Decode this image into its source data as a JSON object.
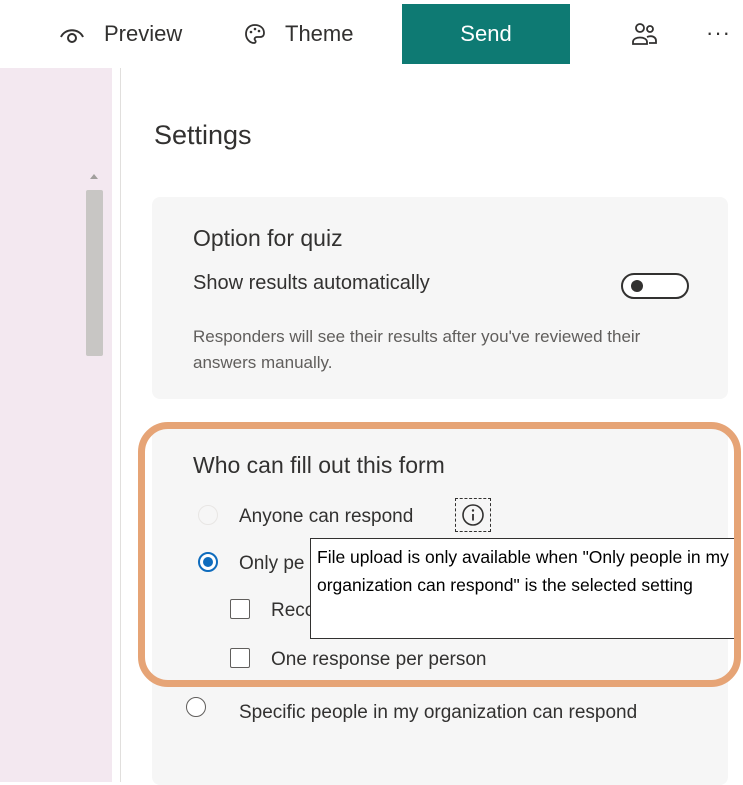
{
  "toolbar": {
    "preview_label": "Preview",
    "preview_icon": "eye-icon",
    "theme_label": "Theme",
    "theme_icon": "palette-icon",
    "send_label": "Send",
    "send_color": "#0e7a73",
    "share_icon": "people-icon",
    "more_label": "···"
  },
  "settings": {
    "title": "Settings",
    "quiz": {
      "title": "Option for quiz",
      "show_results_label": "Show results automatically",
      "show_results_on": false,
      "hint": "Responders will see their results after you've reviewed their answers manually."
    },
    "who": {
      "title": "Who can fill out this form",
      "options": [
        {
          "label": "Anyone can respond",
          "selected": false,
          "disabled": true
        },
        {
          "label": "Only pe",
          "selected": true,
          "disabled": false
        },
        {
          "label": "Specific people in my organization can respond",
          "selected": false,
          "disabled": false
        }
      ],
      "sub_options": [
        {
          "label": "Reco",
          "checked": false
        },
        {
          "label": "One response per person",
          "checked": false
        }
      ],
      "tooltip": "File upload is only available when \"Only people in my organization can respond\" is the selected setting"
    }
  },
  "colors": {
    "accent": "#0e7a73",
    "radio_selected": "#0f6cbd",
    "highlight_ring": "#e6a476",
    "left_pane": "#f3e8f0"
  }
}
